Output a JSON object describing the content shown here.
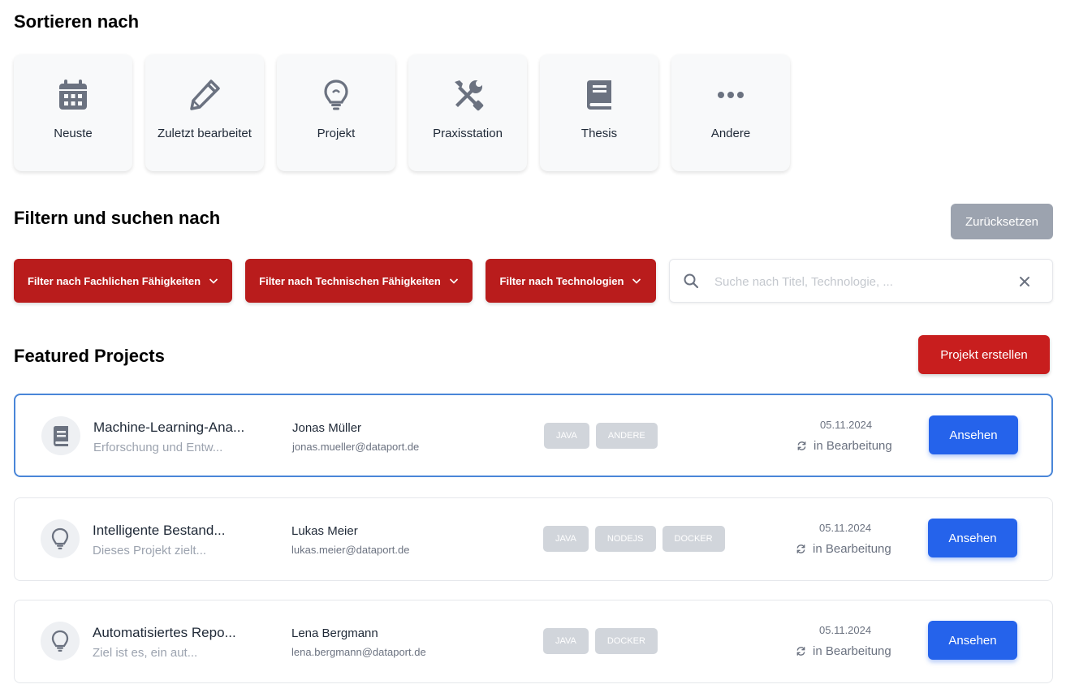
{
  "sort": {
    "heading": "Sortieren nach",
    "options": [
      {
        "label": "Neuste",
        "icon": "calendar-icon"
      },
      {
        "label": "Zuletzt bearbeitet",
        "icon": "pencil-icon"
      },
      {
        "label": "Projekt",
        "icon": "lightbulb-icon"
      },
      {
        "label": "Praxisstation",
        "icon": "tools-icon"
      },
      {
        "label": "Thesis",
        "icon": "book-icon"
      },
      {
        "label": "Andere",
        "icon": "ellipsis-icon"
      }
    ]
  },
  "filter": {
    "heading": "Filtern und suchen nach",
    "reset_label": "Zurücksetzen",
    "buttons": [
      {
        "label": "Filter nach Fachlichen Fähigkeiten"
      },
      {
        "label": "Filter nach Technischen Fähigkeiten"
      },
      {
        "label": "Filter nach Technologien"
      }
    ],
    "search_placeholder": "Suche nach Titel, Technologie, ...",
    "search_value": ""
  },
  "featured": {
    "heading": "Featured Projects",
    "create_label": "Projekt erstellen",
    "view_label": "Ansehen",
    "projects": [
      {
        "title": "Machine-Learning-Ana...",
        "description": "Erforschung und Entw...",
        "name": "Jonas Müller",
        "email": "jonas.mueller@dataport.de",
        "tags": [
          "JAVA",
          "ANDERE"
        ],
        "date": "05.11.2024",
        "status": "in Bearbeitung",
        "icon": "book-icon"
      },
      {
        "title": "Intelligente Bestand...",
        "description": "Dieses Projekt zielt...",
        "name": "Lukas Meier",
        "email": "lukas.meier@dataport.de",
        "tags": [
          "JAVA",
          "NODEJS",
          "DOCKER"
        ],
        "date": "05.11.2024",
        "status": "in Bearbeitung",
        "icon": "lightbulb-icon"
      },
      {
        "title": "Automatisiertes Repo...",
        "description": "Ziel ist es, ein aut...",
        "name": "Lena Bergmann",
        "email": "lena.bergmann@dataport.de",
        "tags": [
          "JAVA",
          "DOCKER"
        ],
        "date": "05.11.2024",
        "status": "in Bearbeitung",
        "icon": "lightbulb-icon"
      }
    ]
  },
  "colors": {
    "primary_red": "#b91c1c",
    "view_blue": "#2563eb",
    "muted_gray": "#9ca3af",
    "active_border": "#4a86d8"
  }
}
